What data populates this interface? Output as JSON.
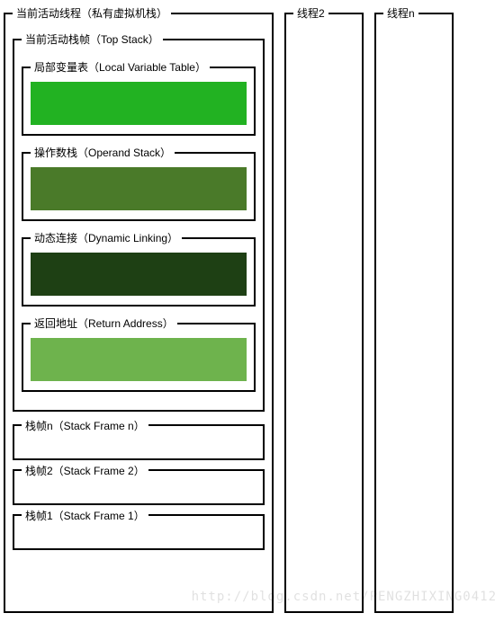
{
  "mainThread": {
    "title": "当前活动线程（私有虚拟机栈）",
    "topStack": {
      "title": "当前活动栈帧（Top Stack）",
      "sections": [
        {
          "label": "局部变量表（Local Variable Table）",
          "colorClass": "c1"
        },
        {
          "label": "操作数栈（Operand Stack）",
          "colorClass": "c2"
        },
        {
          "label": "动态连接（Dynamic Linking）",
          "colorClass": "c3"
        },
        {
          "label": "返回地址（Return Address）",
          "colorClass": "c4"
        }
      ]
    },
    "frames": [
      "栈帧n（Stack Frame n）",
      "栈帧2（Stack Frame 2）",
      "栈帧1（Stack Frame 1）"
    ]
  },
  "thread2": "线程2",
  "threadN": "线程n",
  "watermark": "http://blog.csdn.net/PENGZHIXING0412"
}
